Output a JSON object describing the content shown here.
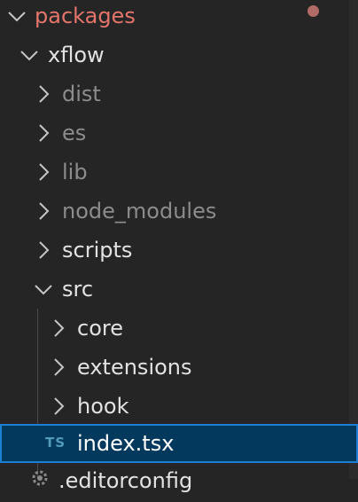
{
  "explorer": {
    "root": {
      "label": "packages",
      "modified_color": "#b06b66"
    },
    "xflow": {
      "label": "xflow"
    },
    "items": [
      {
        "label": "dist",
        "icon": "chevron-right-icon",
        "ignored": true
      },
      {
        "label": "es",
        "icon": "chevron-right-icon",
        "ignored": true
      },
      {
        "label": "lib",
        "icon": "chevron-right-icon",
        "ignored": true
      },
      {
        "label": "node_modules",
        "icon": "chevron-right-icon",
        "ignored": true
      },
      {
        "label": "scripts",
        "icon": "chevron-right-icon",
        "ignored": false
      },
      {
        "label": "src",
        "icon": "chevron-down-icon",
        "ignored": false
      }
    ],
    "src_children": [
      {
        "label": "core",
        "icon": "chevron-right-icon"
      },
      {
        "label": "extensions",
        "icon": "chevron-right-icon"
      },
      {
        "label": "hook",
        "icon": "chevron-right-icon"
      }
    ],
    "selected_file": {
      "badge": "TS",
      "label": "index.tsx",
      "icon": "typescript-icon"
    },
    "partial_file": {
      "label": ".editorconfig",
      "icon": "gear-icon"
    }
  },
  "colors": {
    "background": "#252526",
    "selection_bg": "#04395e",
    "selection_border": "#1b7fd6",
    "root_text": "#e4756b",
    "ts_badge": "#519aba"
  }
}
